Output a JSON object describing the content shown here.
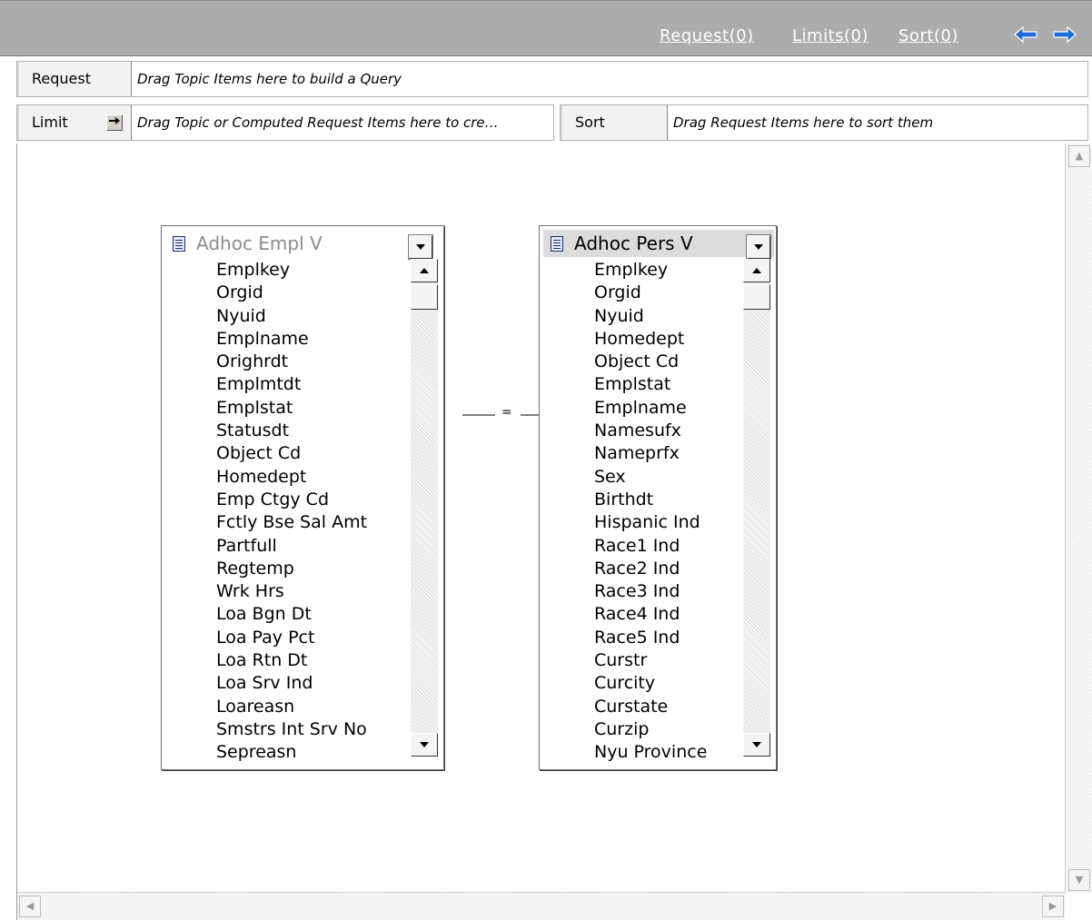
{
  "toolbar": {
    "request_link": "Request(0)",
    "limits_link": "Limits(0)",
    "sort_link": "Sort(0)",
    "back_icon": "left-arrow-icon",
    "forward_icon": "right-arrow-icon",
    "accent_color": "#1d6fe0"
  },
  "request_row": {
    "label": "Request",
    "hint": "Drag Topic Items here to build a Query"
  },
  "limit_row": {
    "label": "Limit",
    "arrow_icon": "right-arrow-icon",
    "hint": "Drag Topic or Computed Request Items here to cre…"
  },
  "sort_row": {
    "label": "Sort",
    "hint": "Drag Request Items here to sort them"
  },
  "join": {
    "operator": "="
  },
  "tables": [
    {
      "title": "Adhoc Empl V",
      "selected": false,
      "fields": [
        "Emplkey",
        "Orgid",
        "Nyuid",
        "Emplname",
        "Orighrdt",
        "Emplmtdt",
        "Emplstat",
        "Statusdt",
        "Object Cd",
        "Homedept",
        "Emp Ctgy Cd",
        "Fctly Bse Sal Amt",
        "Partfull",
        "Regtemp",
        "Wrk Hrs",
        "Loa Bgn Dt",
        "Loa Pay Pct",
        "Loa Rtn Dt",
        "Loa Srv Ind",
        "Loareasn",
        "Smstrs Int Srv No",
        "Sepreasn"
      ]
    },
    {
      "title": "Adhoc Pers V",
      "selected": true,
      "fields": [
        "Emplkey",
        "Orgid",
        "Nyuid",
        "Homedept",
        "Object Cd",
        "Emplstat",
        "Emplname",
        "Namesufx",
        "Nameprfx",
        "Sex",
        "Birthdt",
        "Hispanic Ind",
        "Race1 Ind",
        "Race2 Ind",
        "Race3 Ind",
        "Race4 Ind",
        "Race5 Ind",
        "Curstr",
        "Curcity",
        "Curstate",
        "Curzip",
        "Nyu Province"
      ]
    }
  ]
}
